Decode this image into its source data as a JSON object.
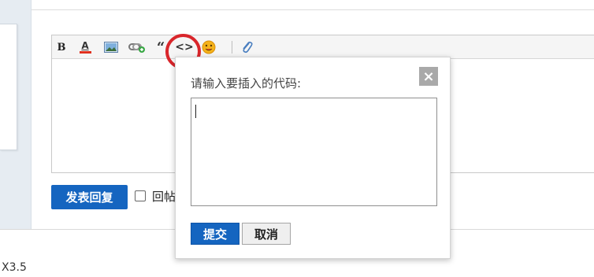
{
  "editor": {
    "toolbar": {
      "bold_glyph": "B",
      "color_glyph": "A",
      "color_bar_color": "#e0301e",
      "quote_glyph": "“",
      "code_glyph": "<>",
      "icons": [
        "bold-icon",
        "font-color-icon",
        "image-icon",
        "link-icon",
        "quote-icon",
        "code-icon",
        "smiley-icon",
        "attachment-icon"
      ]
    },
    "submit_label": "发表回复",
    "reply_label": "回帖"
  },
  "popup": {
    "title": "请输入要插入的代码:",
    "close_glyph": "×",
    "code_value": "",
    "submit_label": "提交",
    "cancel_label": "取消"
  },
  "footer": {
    "version": "X3.5"
  },
  "colors": {
    "primary_blue": "#1565c0",
    "highlight_red": "#d9262b",
    "gutter": "#e6ecf2"
  }
}
